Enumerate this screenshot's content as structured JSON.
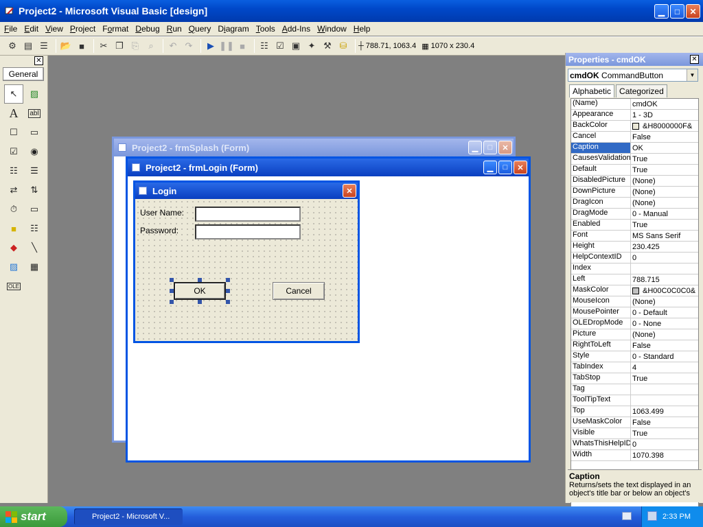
{
  "window": {
    "title": "Project2 - Microsoft Visual Basic [design]"
  },
  "menu": [
    {
      "label": "File",
      "u": "F",
      "rest": "ile"
    },
    {
      "label": "Edit",
      "u": "E",
      "rest": "dit"
    },
    {
      "label": "View",
      "u": "V",
      "rest": "iew"
    },
    {
      "label": "Project",
      "u": "P",
      "rest": "roject"
    },
    {
      "label": "Format",
      "u": "o",
      "pre": "F",
      "rest": "rmat"
    },
    {
      "label": "Debug",
      "u": "D",
      "rest": "ebug"
    },
    {
      "label": "Run",
      "u": "R",
      "rest": "un"
    },
    {
      "label": "Query",
      "u": "Q",
      "rest": "uery"
    },
    {
      "label": "Diagram",
      "u": "i",
      "pre": "D",
      "rest": "agram"
    },
    {
      "label": "Tools",
      "u": "T",
      "rest": "ools"
    },
    {
      "label": "Add-Ins",
      "u": "A",
      "rest": "dd-Ins"
    },
    {
      "label": "Window",
      "u": "W",
      "rest": "indow"
    },
    {
      "label": "Help",
      "u": "H",
      "rest": "elp"
    }
  ],
  "toolbar": {
    "position": "788.71, 1063.4",
    "size": "1070 x 230.4"
  },
  "toolbox": {
    "tab": "General"
  },
  "forms": {
    "splash_title": "Project2 - frmSplash (Form)",
    "login_title": "Project2 - frmLogin (Form)"
  },
  "login": {
    "title": "Login",
    "username_label": "User Name:",
    "password_label": "Password:",
    "ok_label": "OK",
    "cancel_label": "Cancel"
  },
  "properties": {
    "title": "Properties - cmdOK",
    "object_name": "cmdOK",
    "object_type": "CommandButton",
    "tab_alpha": "Alphabetic",
    "tab_cat": "Categorized",
    "rows": [
      {
        "name": "(Name)",
        "value": "cmdOK"
      },
      {
        "name": "Appearance",
        "value": "1 - 3D"
      },
      {
        "name": "BackColor",
        "value": "&H8000000F&",
        "swatch": "#ece9d8"
      },
      {
        "name": "Cancel",
        "value": "False"
      },
      {
        "name": "Caption",
        "value": "OK",
        "selected": true
      },
      {
        "name": "CausesValidation",
        "value": "True"
      },
      {
        "name": "Default",
        "value": "True"
      },
      {
        "name": "DisabledPicture",
        "value": "(None)"
      },
      {
        "name": "DownPicture",
        "value": "(None)"
      },
      {
        "name": "DragIcon",
        "value": "(None)"
      },
      {
        "name": "DragMode",
        "value": "0 - Manual"
      },
      {
        "name": "Enabled",
        "value": "True"
      },
      {
        "name": "Font",
        "value": "MS Sans Serif"
      },
      {
        "name": "Height",
        "value": "230.425"
      },
      {
        "name": "HelpContextID",
        "value": "0"
      },
      {
        "name": "Index",
        "value": ""
      },
      {
        "name": "Left",
        "value": "788.715"
      },
      {
        "name": "MaskColor",
        "value": "&H00C0C0C0&",
        "swatch": "#c0c0c0"
      },
      {
        "name": "MouseIcon",
        "value": "(None)"
      },
      {
        "name": "MousePointer",
        "value": "0 - Default"
      },
      {
        "name": "OLEDropMode",
        "value": "0 - None"
      },
      {
        "name": "Picture",
        "value": "(None)"
      },
      {
        "name": "RightToLeft",
        "value": "False"
      },
      {
        "name": "Style",
        "value": "0 - Standard"
      },
      {
        "name": "TabIndex",
        "value": "4"
      },
      {
        "name": "TabStop",
        "value": "True"
      },
      {
        "name": "Tag",
        "value": ""
      },
      {
        "name": "ToolTipText",
        "value": ""
      },
      {
        "name": "Top",
        "value": "1063.499"
      },
      {
        "name": "UseMaskColor",
        "value": "False"
      },
      {
        "name": "Visible",
        "value": "True"
      },
      {
        "name": "WhatsThisHelpID",
        "value": "0"
      },
      {
        "name": "Width",
        "value": "1070.398"
      }
    ],
    "desc_title": "Caption",
    "desc_text": "Returns/sets the text displayed in an object's title bar or below an object's"
  },
  "taskbar": {
    "start": "start",
    "task": "Project2 - Microsoft V...",
    "clock": "2:33 PM"
  },
  "colors": {
    "title_blue": "#0048c9",
    "xp_green": "#3a9a3a",
    "face": "#ece9d8"
  }
}
